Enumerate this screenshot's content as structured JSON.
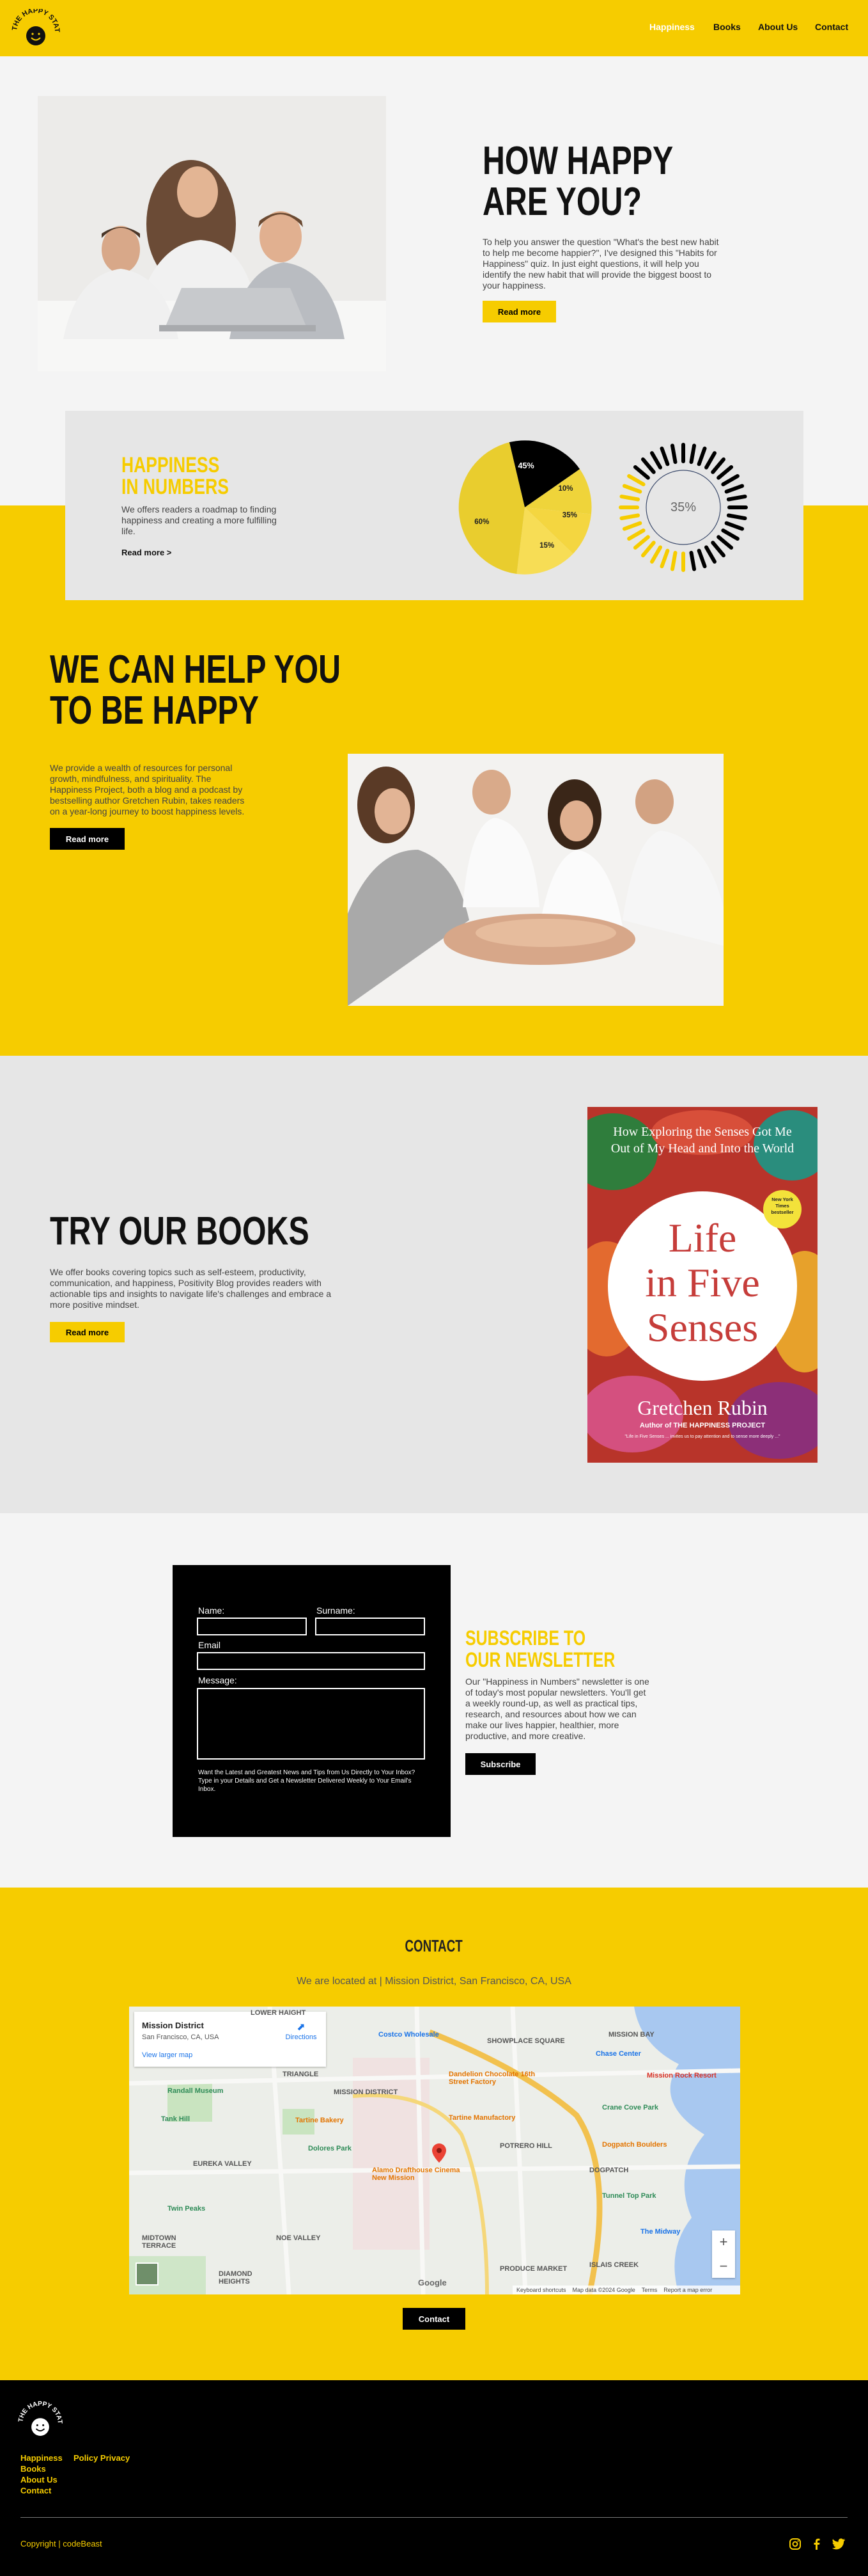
{
  "header": {
    "logo_text": "THE HAPPY STATE",
    "nav": [
      {
        "label": "Happiness"
      },
      {
        "label": "Books"
      },
      {
        "label": "About Us"
      },
      {
        "label": "Contact"
      }
    ]
  },
  "hero": {
    "title_line1": "HOW HAPPY",
    "title_line2": "ARE YOU?",
    "text": "To help you answer the question \"What's the best new habit to help me become happier?\", I've designed this \"Habits for Happiness\" quiz. In just eight questions, it will help you identify the new habit that will provide the biggest boost to your happiness.",
    "button": "Read more"
  },
  "numbers": {
    "title_line1": "HAPPINESS",
    "title_line2": "IN NUMBERS",
    "text": "We offers readers a roadmap to finding happiness and creating a more fulfilling life.",
    "link": "Read more >",
    "pie_labels": [
      "45%",
      "10%",
      "35%",
      "15%",
      "60%"
    ],
    "gauge_label": "35%",
    "colors": {
      "dark": "#000000",
      "yellow": "#f6cc00",
      "light_yellow": "#f7dc4a",
      "mid_yellow": "#e8c820"
    }
  },
  "help": {
    "title_line1": "WE CAN HELP YOU",
    "title_line2": "TO BE HAPPY",
    "text": "We provide a wealth of resources for personal growth, mindfulness, and spirituality. The Happiness Project, both a blog and a podcast by bestselling author Gretchen Rubin, takes readers on a year-long journey to boost happiness levels.",
    "button": "Read more"
  },
  "books": {
    "title": "TRY OUR BOOKS",
    "text": "We offer books covering topics such as self-esteem, productivity, communication, and happiness, Positivity Blog provides readers with actionable tips and insights to navigate life's challenges and embrace a more positive mindset.",
    "button": "Read more",
    "cover": {
      "tagline": "How Exploring the Senses Got Me Out of My Head and Into the World",
      "title_line1": "Life",
      "title_line2": "in Five",
      "title_line3": "Senses",
      "author": "Gretchen Rubin",
      "author_sub": "Author of THE HAPPINESS PROJECT",
      "badge": "New York Times bestseller",
      "quote": "\"Life in Five Senses ... invites us to pay attention and to sense more deeply ...\""
    }
  },
  "newsletter": {
    "name_label": "Name:",
    "surname_label": "Surname:",
    "email_label": "Email",
    "message_label": "Message:",
    "note": "Want the Latest and Greatest News and Tips from Us Directly to Your Inbox? Type in your Details and Get a Newsletter Delivered Weekly to Your Email's Inbox.",
    "title_line1": "SUBSCRIBE TO",
    "title_line2": "OUR NEWSLETTER",
    "text": "Our \"Happiness in Numbers\" newsletter is one of today's most popular newsletters. You'll get a weekly round-up, as well as practical tips, research, and resources about how we can make our lives happier, healthier, more productive, and more creative.",
    "button": "Subscribe"
  },
  "contact": {
    "title": "CONTACT",
    "location": "We are located at | Mission District, San Francisco, CA, USA",
    "map": {
      "place": "Mission District",
      "address": "San Francisco, CA, USA",
      "directions": "Directions",
      "larger_map": "View larger map",
      "labels": [
        "LOWER HAIGHT",
        "Costco Wholesale",
        "SHOWPLACE SQUARE",
        "MISSION BAY",
        "Chase Center",
        "Randall Museum",
        "TRIANGLE",
        "MISSION DISTRICT",
        "Dandelion Chocolate 16th Street Factory",
        "Mission Rock Resort",
        "Tank Hill",
        "Tartine Bakery",
        "Tartine Manufactory",
        "Crane Cove Park",
        "EUREKA VALLEY",
        "Dolores Park",
        "POTRERO HILL",
        "Dogpatch Boulders",
        "Twin Peaks",
        "Alamo Drafthouse Cinema New Mission",
        "DOGPATCH",
        "Tunnel Top Park",
        "NOE VALLEY",
        "MIDTOWN TERRACE",
        "DIAMOND HEIGHTS",
        "The Midway",
        "ISLAIS CREEK",
        "PRODUCE MARKET"
      ],
      "footer": [
        "Keyboard shortcuts",
        "Map data ©2024 Google",
        "Terms",
        "Report a map error"
      ],
      "google": "Google",
      "zoom_in": "+",
      "zoom_out": "−"
    },
    "button": "Contact"
  },
  "footer": {
    "logo_text": "THE HAPPY STATE",
    "links": [
      "Happiness",
      "Policy Privacy",
      "Books",
      "About Us",
      "Contact"
    ],
    "copyright": "Copyright | codeBeast"
  }
}
